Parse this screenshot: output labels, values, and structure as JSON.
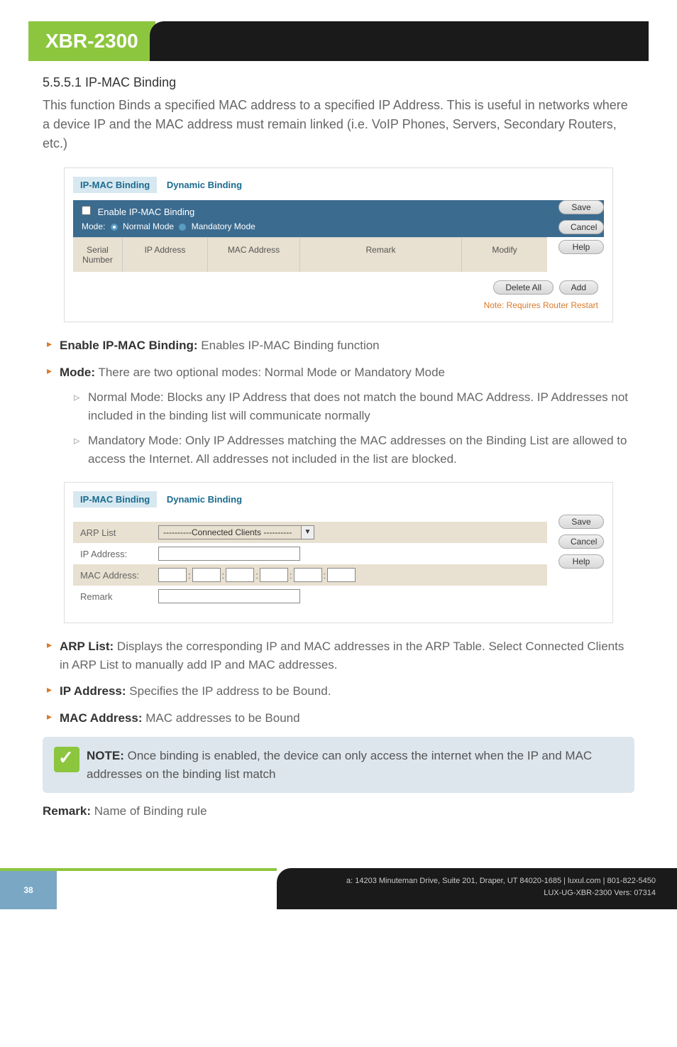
{
  "header": {
    "model": "XBR-2300"
  },
  "section": {
    "number": "5.5.5.1 IP-MAC Binding",
    "intro": "This function Binds a specified MAC address to a specified IP Address. This is useful in networks where a device IP and the MAC address must remain linked (i.e. VoIP Phones, Servers, Secondary Routers, etc.)"
  },
  "shot1": {
    "tab1": "IP-MAC Binding",
    "tab2": "Dynamic Binding",
    "enable_label": "Enable IP-MAC Binding",
    "mode_label": "Mode:",
    "mode_normal": "Normal Mode",
    "mode_mandatory": "Mandatory Mode",
    "col_serial": "Serial Number",
    "col_ip": "IP Address",
    "col_mac": "MAC Address",
    "col_remark": "Remark",
    "col_modify": "Modify",
    "btn_save": "Save",
    "btn_cancel": "Cancel",
    "btn_help": "Help",
    "btn_delete": "Delete All",
    "btn_add": "Add",
    "note": "Note: Requires Router Restart"
  },
  "bullets1": {
    "enable_label": "Enable IP-MAC Binding:",
    "enable_text": " Enables IP-MAC Binding function",
    "mode_label": "Mode:",
    "mode_text": " There are two optional modes: Normal Mode or Mandatory Mode",
    "sub_normal": "Normal Mode: Blocks any IP Address that does not match the bound MAC Address. IP Addresses not included in the binding list will communicate normally",
    "sub_mandatory": "Mandatory Mode: Only IP Addresses matching the MAC addresses on the Binding List are allowed to access the Internet. All addresses not included in the list are blocked."
  },
  "shot2": {
    "tab1": "IP-MAC Binding",
    "tab2": "Dynamic Binding",
    "arp_label": "ARP List",
    "arp_value": "----------Connected Clients ----------",
    "ip_label": "IP Address:",
    "mac_label": "MAC Address:",
    "remark_label": "Remark",
    "btn_save": "Save",
    "btn_cancel": "Cancel",
    "btn_help": "Help"
  },
  "bullets2": {
    "arp_label": "ARP List:",
    "arp_text": " Displays the corresponding IP and MAC addresses in the ARP Table. Select Connected Clients in ARP List to manually add IP and MAC addresses.",
    "ip_label": "IP Address:",
    "ip_text": " Specifies the IP address to be Bound.",
    "mac_label": "MAC Address:",
    "mac_text": " MAC addresses to be Bound"
  },
  "note_block": {
    "label": "NOTE:",
    "text": " Once binding is enabled, the device can only access the internet when the IP and MAC addresses on the binding list match"
  },
  "remark": {
    "label": "Remark:",
    "text": " Name of Binding rule"
  },
  "footer": {
    "page": "38",
    "addr": "a: 14203 Minuteman Drive, Suite 201, Draper, UT 84020-1685 | luxul.com | 801-822-5450",
    "ver": "LUX-UG-XBR-2300  Vers: 07314"
  }
}
